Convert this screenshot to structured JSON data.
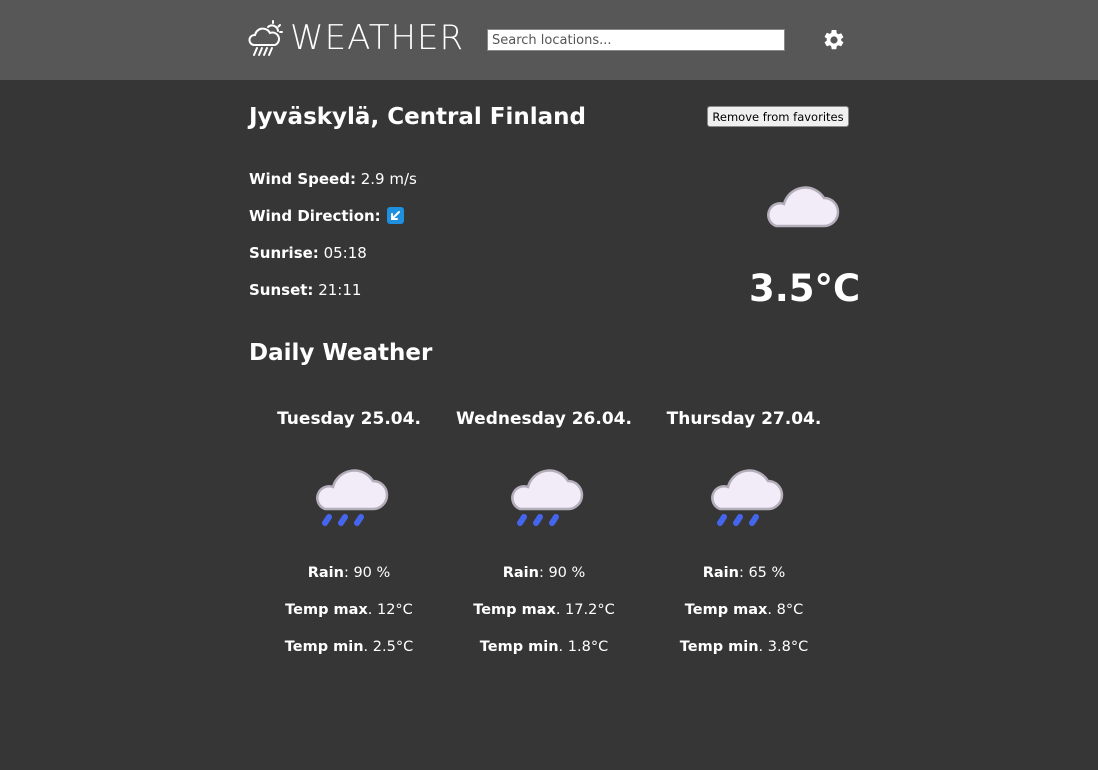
{
  "header": {
    "logo_text": "WEATHER",
    "logo_icon": "cloud-rain-sun-icon",
    "search_placeholder": "Search locations...",
    "settings_icon": "gear-icon"
  },
  "location": {
    "name": "Jyväskylä, Central Finland",
    "favorite_button": "Remove from favorites",
    "wind_speed_label": "Wind Speed:",
    "wind_speed_value": "2.9 m/s",
    "wind_direction_label": "Wind Direction:",
    "wind_direction_icon": "arrow-down-left-icon",
    "sunrise_label": "Sunrise:",
    "sunrise_value": "05:18",
    "sunset_label": "Sunset:",
    "sunset_value": "21:11",
    "current_icon": "cloud-icon",
    "current_temp": "3.5°C"
  },
  "daily": {
    "title": "Daily Weather",
    "rain_label": "Rain",
    "max_label": "Temp max",
    "min_label": "Temp min",
    "days": [
      {
        "date": "Tuesday 25.04.",
        "icon": "cloud-rain-icon",
        "rain": ": 90 %",
        "max": ". 12°C",
        "min": ". 2.5°C"
      },
      {
        "date": "Wednesday 26.04.",
        "icon": "cloud-rain-icon",
        "rain": ": 90 %",
        "max": ". 17.2°C",
        "min": ". 1.8°C"
      },
      {
        "date": "Thursday 27.04.",
        "icon": "cloud-rain-icon",
        "rain": ": 65 %",
        "max": ". 8°C",
        "min": ". 3.8°C"
      }
    ]
  },
  "colors": {
    "background": "#363636",
    "header": "#575757",
    "cloud_fill": "#f1ecf7",
    "cloud_stroke": "#b4aebb",
    "rain": "#4466ee",
    "wind_icon": "#1f8fe0"
  }
}
